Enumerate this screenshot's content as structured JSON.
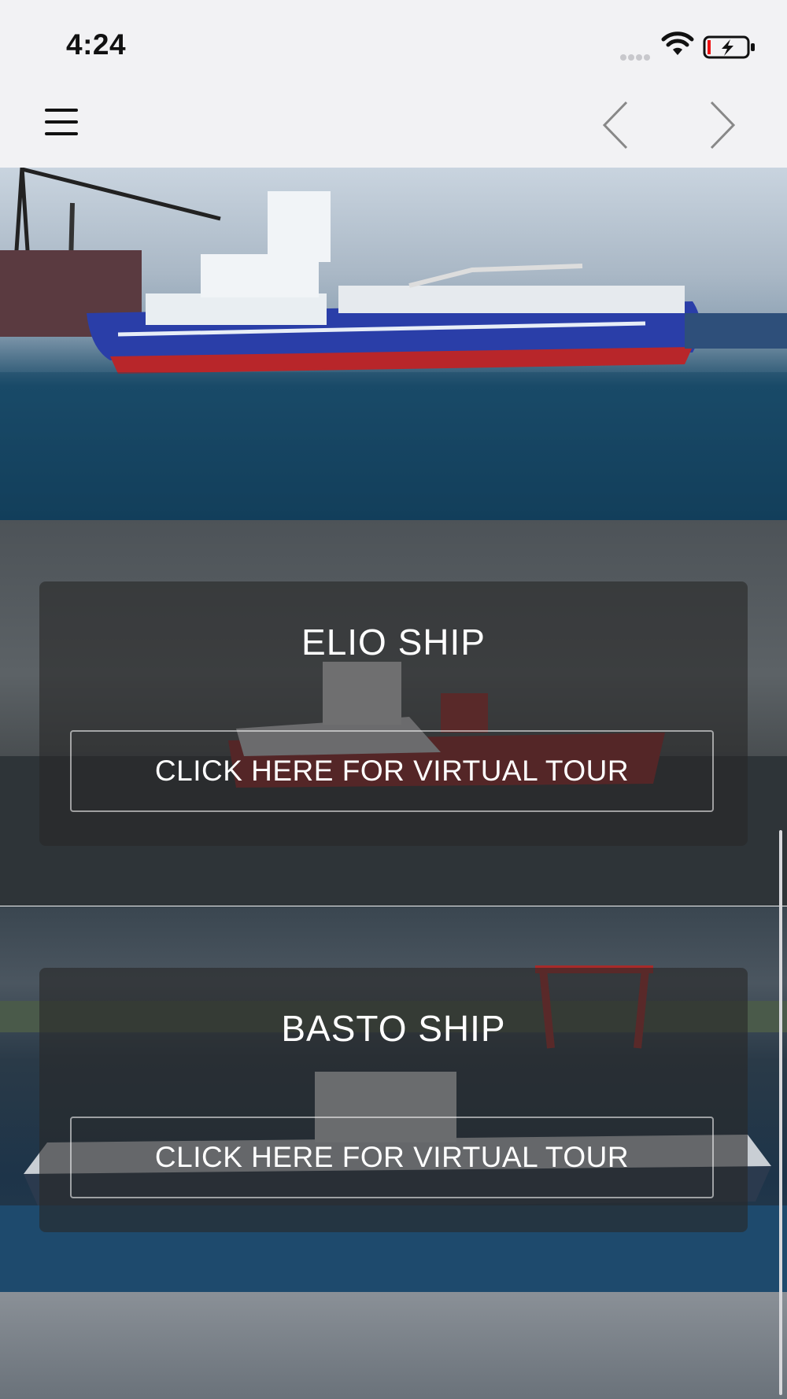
{
  "status_bar": {
    "time": "4:24",
    "icons": [
      "signal-icon",
      "wifi-icon",
      "battery-charging-icon"
    ]
  },
  "nav_bar": {
    "icons": [
      "hamburger-menu-icon",
      "chevron-left-icon",
      "chevron-right-icon"
    ]
  },
  "ships": [
    {
      "title": "ELIO SHIP",
      "button_label": "CLICK HERE FOR VIRTUAL TOUR"
    },
    {
      "title": "BASTO SHIP",
      "button_label": "CLICK HERE FOR VIRTUAL TOUR"
    }
  ],
  "colors": {
    "hull_blue": "#2a3ea8",
    "hull_red": "#b8262a",
    "card_overlay": "#282828"
  }
}
